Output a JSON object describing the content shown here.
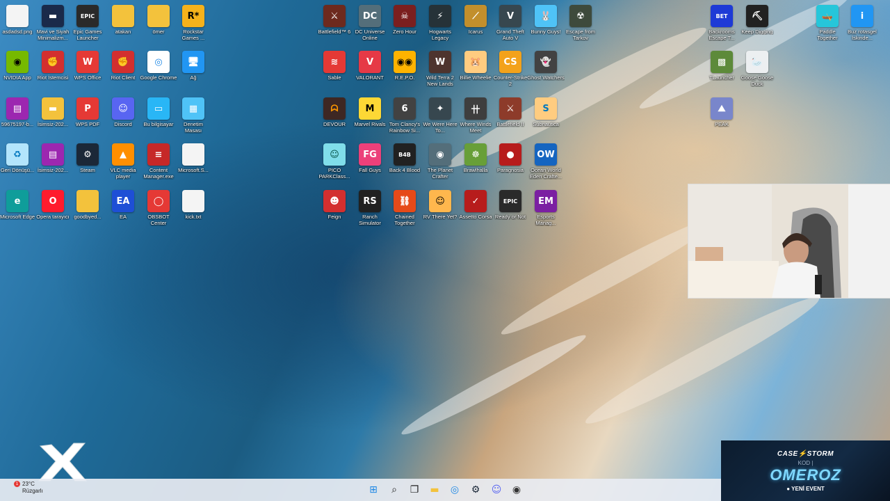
{
  "desktop": {
    "icons": [
      {
        "label": "asdadsd.png",
        "glyph": "",
        "color": "#f4f4f4",
        "fg": "#333"
      },
      {
        "label": "Mavi ve Siyah Minimalizm...",
        "glyph": "▬",
        "color": "#1a2a4a",
        "fg": "#fff"
      },
      {
        "label": "Epic Games Launcher",
        "glyph": "EPIC",
        "color": "#2a2a2a",
        "fg": "#fff"
      },
      {
        "label": "atakan",
        "glyph": "",
        "color": "#f3c23c",
        "fg": "#fff"
      },
      {
        "label": "ömer",
        "glyph": "",
        "color": "#f3c23c",
        "fg": "#fff"
      },
      {
        "label": "Rockstar Games ...",
        "glyph": "R*",
        "color": "#f6b21b",
        "fg": "#000"
      },
      {
        "label": "NVIDIA App",
        "glyph": "◉",
        "color": "#76b900",
        "fg": "#000"
      },
      {
        "label": "Riot İstemcisi",
        "glyph": "✊",
        "color": "#d32f2f",
        "fg": "#fff"
      },
      {
        "label": "WPS Office",
        "glyph": "W",
        "color": "#e53935",
        "fg": "#fff"
      },
      {
        "label": "Riot Client",
        "glyph": "✊",
        "color": "#d32f2f",
        "fg": "#fff"
      },
      {
        "label": "Google Chrome",
        "glyph": "◎",
        "color": "#ffffff",
        "fg": "#1e88e5"
      },
      {
        "label": "Ağ",
        "glyph": "🖥",
        "color": "#2196f3",
        "fg": "#fff"
      },
      {
        "label": "59675197-b...",
        "glyph": "▤",
        "color": "#9c27b0",
        "fg": "#fff"
      },
      {
        "label": "İsimsiz-202...",
        "glyph": "▬",
        "color": "#f3c23c",
        "fg": "#fff"
      },
      {
        "label": "WPS PDF",
        "glyph": "P",
        "color": "#e53935",
        "fg": "#fff"
      },
      {
        "label": "Discord",
        "glyph": "☺",
        "color": "#5865f2",
        "fg": "#fff"
      },
      {
        "label": "Bu bilgisayar",
        "glyph": "▭",
        "color": "#29b6f6",
        "fg": "#fff"
      },
      {
        "label": "Denetim Masası",
        "glyph": "▦",
        "color": "#4fc3f7",
        "fg": "#fff"
      },
      {
        "label": "Geri Dönüşü...",
        "glyph": "♻",
        "color": "#b3e5fc",
        "fg": "#0277bd"
      },
      {
        "label": "İsimsiz-202...",
        "glyph": "▤",
        "color": "#9c27b0",
        "fg": "#fff"
      },
      {
        "label": "Steam",
        "glyph": "⚙",
        "color": "#1b2838",
        "fg": "#fff"
      },
      {
        "label": "VLC media player",
        "glyph": "▲",
        "color": "#ff8f00",
        "fg": "#fff"
      },
      {
        "label": "Content Manager.exe",
        "glyph": "≡",
        "color": "#c62828",
        "fg": "#fff"
      },
      {
        "label": "Microsoft.S...",
        "glyph": "",
        "color": "#f4f4f4",
        "fg": "#333"
      },
      {
        "label": "Microsoft Edge",
        "glyph": "e",
        "color": "#0f9d9a",
        "fg": "#fff"
      },
      {
        "label": "Opera tarayıcı",
        "glyph": "O",
        "color": "#ff1b2d",
        "fg": "#fff"
      },
      {
        "label": "goodbyed...",
        "glyph": "",
        "color": "#f3c23c",
        "fg": "#fff"
      },
      {
        "label": "EA",
        "glyph": "EA",
        "color": "#1e4fd6",
        "fg": "#fff"
      },
      {
        "label": "OBSBOT Center",
        "glyph": "◯",
        "color": "#e53935",
        "fg": "#fff"
      },
      {
        "label": "kick.txt",
        "glyph": "",
        "color": "#f4f4f4",
        "fg": "#333"
      },
      {
        "label": "Battlefield™ 6",
        "glyph": "⚔",
        "color": "#6d2a1e",
        "fg": "#fff"
      },
      {
        "label": "DC Universe Online",
        "glyph": "DC",
        "color": "#546e7a",
        "fg": "#fff"
      },
      {
        "label": "Zero Hour",
        "glyph": "☠",
        "color": "#7b1f1f",
        "fg": "#fff"
      },
      {
        "label": "Hogwarts Legacy",
        "glyph": "⚡",
        "color": "#263238",
        "fg": "#fff"
      },
      {
        "label": "Icarus",
        "glyph": "⟋",
        "color": "#c28f2c",
        "fg": "#fff"
      },
      {
        "label": "Grand Theft Auto V",
        "glyph": "V",
        "color": "#37474f",
        "fg": "#fff"
      },
      {
        "label": "Bunny Guys!",
        "glyph": "🐰",
        "color": "#4fc3f7",
        "fg": "#fff"
      },
      {
        "label": "Escape from Tarkov",
        "glyph": "☢",
        "color": "#3e4a3c",
        "fg": "#fff"
      },
      {
        "label": "Sable",
        "glyph": "≋",
        "color": "#e53935",
        "fg": "#fff"
      },
      {
        "label": "VALORANT",
        "glyph": "V",
        "color": "#e63946",
        "fg": "#fff"
      },
      {
        "label": "R.E.P.O.",
        "glyph": "◉◉",
        "color": "#ffb300",
        "fg": "#000"
      },
      {
        "label": "Wild Terra 2 New Lands",
        "glyph": "W",
        "color": "#4e342e",
        "fg": "#fff"
      },
      {
        "label": "Billie Wheelie",
        "glyph": "🐹",
        "color": "#ffcc80",
        "fg": "#000"
      },
      {
        "label": "Counter-Strike 2",
        "glyph": "CS",
        "color": "#f3a21b",
        "fg": "#fff"
      },
      {
        "label": "Ghost Watchers",
        "glyph": "👻",
        "color": "#424242",
        "fg": "#fff"
      },
      {
        "label": "DEVOUR",
        "glyph": "ᗣ",
        "color": "#3e2723",
        "fg": "#ff9800"
      },
      {
        "label": "Marvel Rivals",
        "glyph": "M",
        "color": "#fdd835",
        "fg": "#000"
      },
      {
        "label": "Tom Clancy's Rainbow Si...",
        "glyph": "6",
        "color": "#424242",
        "fg": "#fff"
      },
      {
        "label": "We Were Here To...",
        "glyph": "✦",
        "color": "#37474f",
        "fg": "#fff"
      },
      {
        "label": "Where Winds Meet",
        "glyph": "卄",
        "color": "#3e3e3e",
        "fg": "#fff"
      },
      {
        "label": "Battlefield II",
        "glyph": "⚔",
        "color": "#8d3b2a",
        "fg": "#fff"
      },
      {
        "label": "Subnautica",
        "glyph": "S",
        "color": "#ffcc80",
        "fg": "#0277bd"
      },
      {
        "label": "PICO PARKClass...",
        "glyph": "☺",
        "color": "#80deea",
        "fg": "#004d40"
      },
      {
        "label": "Fall Guys",
        "glyph": "FG",
        "color": "#ec407a",
        "fg": "#fff"
      },
      {
        "label": "Back 4 Blood",
        "glyph": "B4B",
        "color": "#212121",
        "fg": "#fff"
      },
      {
        "label": "The Planet Crafter",
        "glyph": "◉",
        "color": "#546e7a",
        "fg": "#fff"
      },
      {
        "label": "Brawlhalla",
        "glyph": "☸",
        "color": "#689f38",
        "fg": "#fff"
      },
      {
        "label": "Paragnosia",
        "glyph": "●",
        "color": "#b71c1c",
        "fg": "#fff"
      },
      {
        "label": "Ocean World Eden Crafte...",
        "glyph": "OW",
        "color": "#1565c0",
        "fg": "#fff"
      },
      {
        "label": "Feign",
        "glyph": "☻",
        "color": "#d32f2f",
        "fg": "#fff"
      },
      {
        "label": "Ranch Simulator",
        "glyph": "RS",
        "color": "#212121",
        "fg": "#fff"
      },
      {
        "label": "Chained Together",
        "glyph": "⛓",
        "color": "#e64a19",
        "fg": "#fff"
      },
      {
        "label": "RV There Yet?",
        "glyph": "☺",
        "color": "#ffb74d",
        "fg": "#000"
      },
      {
        "label": "Assetto Corsa",
        "glyph": "✓",
        "color": "#b71c1c",
        "fg": "#fff"
      },
      {
        "label": "Ready or Not",
        "glyph": "EPIC",
        "color": "#2a2a2a",
        "fg": "#fff"
      },
      {
        "label": "Esports Manag...",
        "glyph": "EM",
        "color": "#7b1fa2",
        "fg": "#fff"
      },
      {
        "label": "Backrooms Escape T...",
        "glyph": "BET",
        "color": "#1e3ad6",
        "fg": "#fff"
      },
      {
        "label": "Keep Digging",
        "glyph": "⛏",
        "color": "#212121",
        "fg": "#fff"
      },
      {
        "label": "Paddle Together",
        "glyph": "🛶",
        "color": "#26c6da",
        "fg": "#fff"
      },
      {
        "label": "Buz rotasgel İskinde...",
        "glyph": "i",
        "color": "#2196f3",
        "fg": "#fff"
      },
      {
        "label": "TLauncher",
        "glyph": "▩",
        "color": "#5d8a3a",
        "fg": "#fff"
      },
      {
        "label": "Goose Goose Duck",
        "glyph": "🦢",
        "color": "#eceff1",
        "fg": "#000"
      },
      {
        "label": "PEAK",
        "glyph": "⛰",
        "color": "#7986cb",
        "fg": "#fff"
      }
    ]
  },
  "webcam": {
    "label": "webcam-feed"
  },
  "promo": {
    "brand": "CASE⚡STORM",
    "kod": "KOD |",
    "code": "OMEROZ",
    "event": "● YENİ EVENT"
  },
  "weather": {
    "temp": "23°C",
    "desc": "Rüzgarlı",
    "badge": "1"
  },
  "taskbar": {
    "icons": [
      {
        "name": "start-icon",
        "glyph": "⊞",
        "color": "#1e88e5"
      },
      {
        "name": "search-icon",
        "glyph": "⌕",
        "color": "#222"
      },
      {
        "name": "task-view-icon",
        "glyph": "❐",
        "color": "#222"
      },
      {
        "name": "file-explorer-icon",
        "glyph": "▬",
        "color": "#f3c23c"
      },
      {
        "name": "chrome-icon",
        "glyph": "◎",
        "color": "#1e88e5"
      },
      {
        "name": "steam-icon",
        "glyph": "⚙",
        "color": "#1b2838"
      },
      {
        "name": "discord-icon",
        "glyph": "☺",
        "color": "#5865f2"
      },
      {
        "name": "obs-icon",
        "glyph": "◉",
        "color": "#333"
      }
    ]
  }
}
